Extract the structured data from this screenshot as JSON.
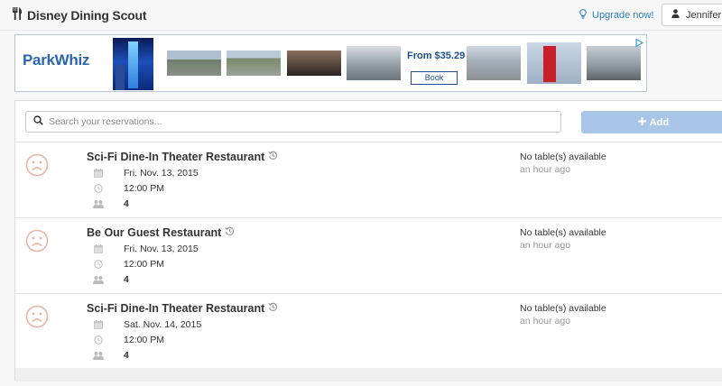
{
  "app": {
    "title": "Disney Dining Scout"
  },
  "header": {
    "upgrade_label": "Upgrade now!",
    "user_name": "Jennifer"
  },
  "ad": {
    "brand": "ParkWhiz",
    "price": "From $35.29",
    "cta": "Book"
  },
  "search": {
    "placeholder": "Search your reservations..."
  },
  "toolbar": {
    "add_label": "Add"
  },
  "reservations": [
    {
      "restaurant": "Sci-Fi Dine-In Theater Restaurant",
      "date": "Fri. Nov. 13, 2015",
      "time": "12:00 PM",
      "party": "4",
      "status": "No table(s) available",
      "updated": "an hour ago"
    },
    {
      "restaurant": "Be Our Guest Restaurant",
      "date": "Fri. Nov. 13, 2015",
      "time": "12:00 PM",
      "party": "4",
      "status": "No table(s) available",
      "updated": "an hour ago"
    },
    {
      "restaurant": "Sci-Fi Dine-In Theater Restaurant",
      "date": "Sat. Nov. 14, 2015",
      "time": "12:00 PM",
      "party": "4",
      "status": "No table(s) available",
      "updated": "an hour ago"
    }
  ],
  "icons": {
    "brand": "fork-knife-icon",
    "upgrade": "lightbulb-icon",
    "user": "user-icon",
    "search": "search-icon",
    "add": "plus-icon",
    "status": "frown-icon",
    "history": "history-icon",
    "date": "calendar-icon",
    "time": "clock-icon",
    "party": "group-icon",
    "ad_info": "info-icon"
  },
  "colors": {
    "link": "#2d7fc1",
    "add_button": "#a9c6e8",
    "frown": "#e8b3a8",
    "ad_brand": "#2a66b3"
  }
}
